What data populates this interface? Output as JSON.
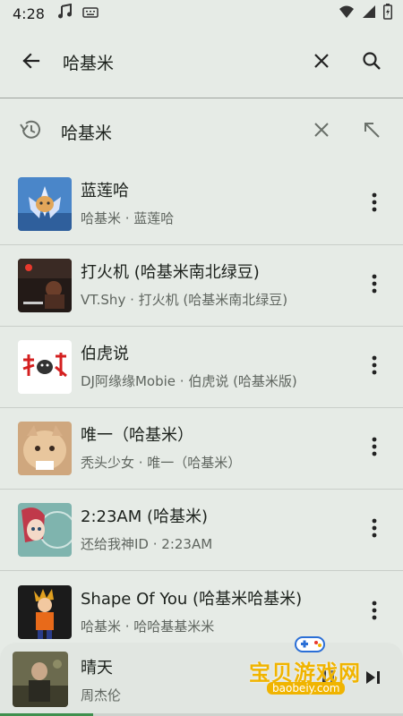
{
  "status_bar": {
    "time": "4:28"
  },
  "search": {
    "query": "哈基米",
    "back_icon": "arrow-left-icon",
    "clear_icon": "close-icon",
    "search_icon": "search-icon"
  },
  "suggestion": {
    "text": "哈基米",
    "history_icon": "history-icon"
  },
  "songs": [
    {
      "title": "蓝莲哈",
      "subtitle": "哈基米 · 蓝莲哈"
    },
    {
      "title": "打火机 (哈基米南北绿豆)",
      "subtitle": "VT.Shy · 打火机 (哈基米南北绿豆)"
    },
    {
      "title": "伯虎说",
      "subtitle": "DJ阿缘缘Mobie · 伯虎说 (哈基米版)"
    },
    {
      "title": "唯一（哈基米）",
      "subtitle": "秃头少女 · 唯一（哈基米）"
    },
    {
      "title": "2:23AM (哈基米)",
      "subtitle": "还给我神ID · 2:23AM"
    },
    {
      "title": "Shape Of You (哈基米哈基米)",
      "subtitle": "哈基米 · 哈哈基基米米"
    }
  ],
  "player": {
    "title": "晴天",
    "artist": "周杰伦",
    "progress": 0.23
  },
  "watermark": {
    "text": "宝贝游戏网",
    "url": "baobeiy.com"
  },
  "colors": {
    "background": "#e6ebe6",
    "accent": "#3f8f4e",
    "text": "#1c211c",
    "secondary_text": "#5f655f"
  }
}
